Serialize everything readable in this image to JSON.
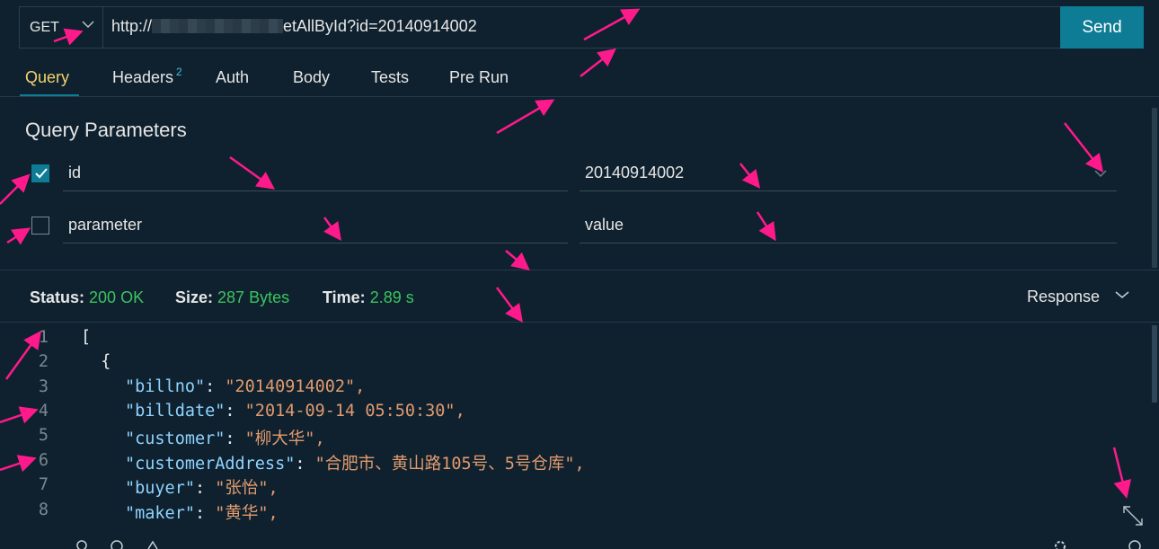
{
  "request": {
    "method": "GET",
    "url_prefix": "http://",
    "url_suffix": "etAllById?id=20140914002",
    "send_label": "Send"
  },
  "tabs": [
    {
      "label": "Query"
    },
    {
      "label": "Headers",
      "badge": "2"
    },
    {
      "label": "Auth"
    },
    {
      "label": "Body"
    },
    {
      "label": "Tests"
    },
    {
      "label": "Pre Run"
    }
  ],
  "query": {
    "title": "Query Parameters",
    "params": [
      {
        "name": "id",
        "value": "20140914002",
        "checked": true
      },
      {
        "name": "parameter",
        "value": "value",
        "checked": false
      }
    ]
  },
  "status": {
    "status_label": "Status:",
    "status_value": "200 OK",
    "size_label": "Size:",
    "size_value": "287 Bytes",
    "time_label": "Time:",
    "time_value": "2.89 s",
    "response_label": "Response"
  },
  "code": {
    "line_numbers": [
      "1",
      "2",
      "3",
      "4",
      "5",
      "6",
      "7",
      "8"
    ],
    "lines": [
      {
        "text": "["
      },
      {
        "text": "  {"
      },
      {
        "key": "\"billno\"",
        "val": "\"20140914002\","
      },
      {
        "key": "\"billdate\"",
        "val": "\"2014-09-14 05:50:30\","
      },
      {
        "key": "\"customer\"",
        "val": "\"柳大华\","
      },
      {
        "key": "\"customerAddress\"",
        "val": "\"合肥市、黄山路105号、5号仓库\","
      },
      {
        "key": "\"buyer\"",
        "val": "\"张怡\","
      },
      {
        "key": "\"maker\"",
        "val": "\"黄华\","
      }
    ]
  },
  "colors": {
    "accent": "#0e7c95",
    "active_tab": "#f1d36d",
    "ok_green": "#3bc45f",
    "annotation_arrows": "#ff1a8c"
  }
}
